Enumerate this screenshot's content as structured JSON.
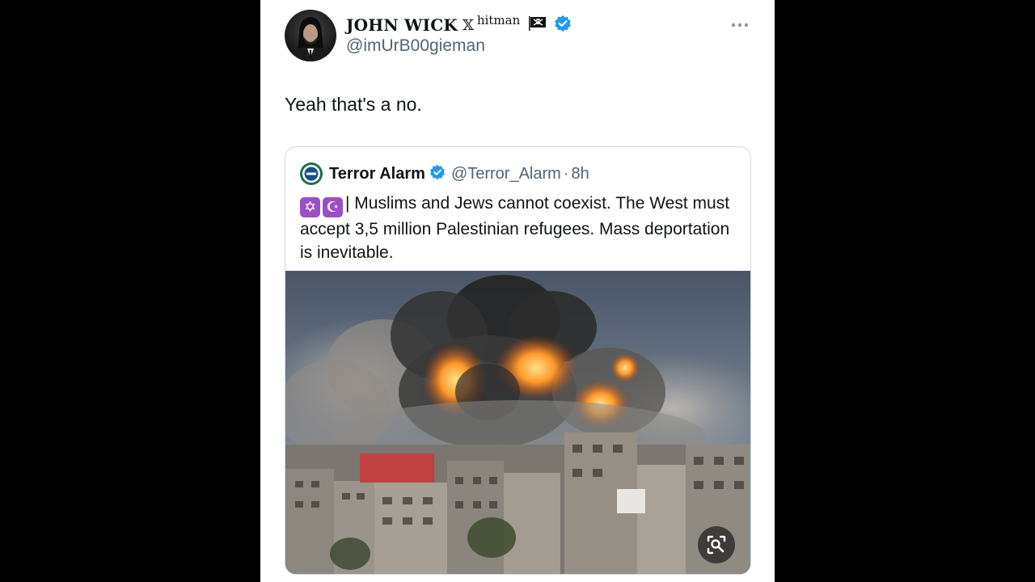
{
  "tweet": {
    "author": {
      "display_name": "JOHN WICK",
      "x_mark": "𝕏",
      "name_suffix": "hitman",
      "flag_icon": "pirate-flag-icon",
      "verified": true,
      "handle": "@imUrB00gieman",
      "avatar_icon": "profile-avatar"
    },
    "text": "Yeah that's a no.",
    "more_icon": "more-horizontal-icon"
  },
  "quote": {
    "author": {
      "display_name": "Terror Alarm",
      "verified": true,
      "handle": "@Terror_Alarm",
      "separator": "·",
      "time": "8h",
      "avatar_icon": "terror-alarm-logo"
    },
    "emoji": [
      "✡",
      "☪"
    ],
    "text": "| Muslims and Jews cannot coexist. The West must accept 3,5 million Palestinian refugees. Mass deportation is inevitable.",
    "media": {
      "icon": "explosion-photo",
      "lens_button_icon": "visual-search-icon"
    }
  },
  "colors": {
    "background": "#000000",
    "card": "#ffffff",
    "text_primary": "#0f1419",
    "text_secondary": "#536471",
    "verified_blue": "#1d9bf0",
    "border": "#cfd9de",
    "emoji_purple": "#9b4fc6"
  }
}
